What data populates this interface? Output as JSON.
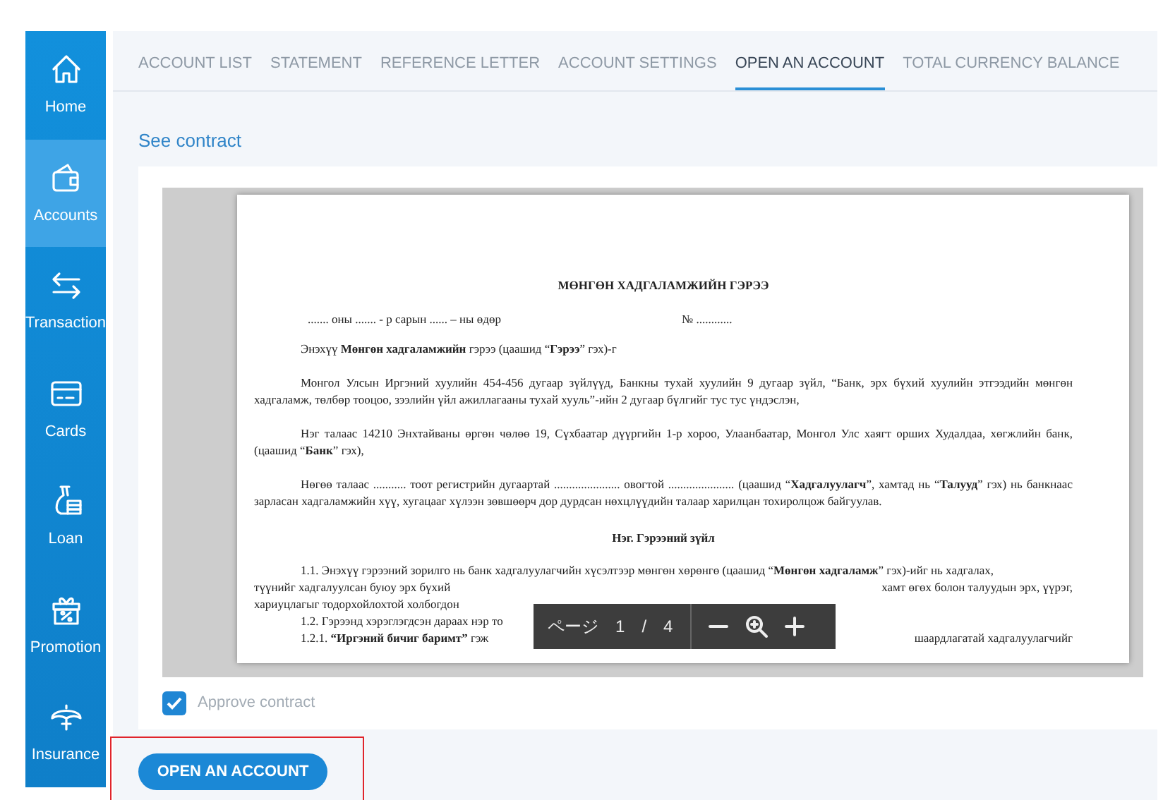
{
  "sidebar": {
    "items": [
      {
        "label": "Home",
        "selected": false
      },
      {
        "label": "Accounts",
        "selected": true
      },
      {
        "label": "Transaction",
        "selected": false
      },
      {
        "label": "Cards",
        "selected": false
      },
      {
        "label": "Loan",
        "selected": false
      },
      {
        "label": "Promotion",
        "selected": false
      },
      {
        "label": "Insurance",
        "selected": false
      }
    ]
  },
  "tabs": [
    {
      "label": "ACCOUNT LIST",
      "selected": false
    },
    {
      "label": "STATEMENT",
      "selected": false
    },
    {
      "label": "REFERENCE LETTER",
      "selected": false
    },
    {
      "label": "ACCOUNT SETTINGS",
      "selected": false
    },
    {
      "label": "OPEN AN ACCOUNT",
      "selected": true
    },
    {
      "label": "TOTAL CURRENCY BALANCE",
      "selected": false
    }
  ],
  "section_title": "See contract",
  "document": {
    "title": "МӨНГӨН ХАДГАЛАМЖИЙН ГЭРЭЭ",
    "date_line": "....... оны ....... - р сарын ...... – ны өдөр",
    "number_line": "№ ............",
    "paragraphs": [
      "Энэхүү **Мөнгөн хадгаламжийн** гэрээ (цаашид “**Гэрээ**” гэх)-г",
      "Монгол Улсын Иргэний хуулийн 454-456 дугаар зүйлүүд, Банкны тухай хуулийн 9 дугаар зүйл, “Банк, эрх бүхий хуулийн этгээдийн мөнгөн хадгаламж, төлбөр тооцоо, зээлийн үйл ажиллагааны тухай хууль”-ийн 2 дугаар бүлгийг тус тус үндэслэн,",
      "Нэг талаас 14210 Энхтайваны өргөн чөлөө 19, Сүхбаатар дүүргийн 1-р хороо, Улаанбаатар, Монгол Улс хаягт орших Худалдаа, хөгжлийн банк, (цаашид “**Банк**” гэх),",
      "Нөгөө талаас ........... тоот регистрийн дугаартай ...................... овогтой ...................... (цаашид “**Хадгалуулагч**”, хамтад нь “**Талууд**” гэх) нь банкнаас зарласан хадгаламжийн хүү, хугацааг хүлээн зөвшөөрч дор дурдсан нөхцлүүдийн талаар харилцан тохиролцож байгуулав."
    ],
    "section_heading": "Нэг. Гэрээний зүйл",
    "lines": [
      {
        "text": "1.1. Энэхүү гэрээний зорилго нь банк хадгалуулагчийн хүсэлтээр мөнгөн хөрөнгө (цаашид “**Мөнгөн хадгаламж**” гэх)-ийг нь хадгалах,",
        "indented": true
      },
      {
        "text": "түүнийг хадгалуулсан буюу эрх бүхий",
        "text_right": "хамт өгөх болон талуудын эрх, үүрэг,",
        "indented": false
      },
      {
        "text": "хариуцлагыг тодорхойлохтой холбогдон",
        "indented": false
      },
      {
        "text": "1.2. Гэрээнд хэрэглэгдсэн дараах нэр то",
        "indented": true
      },
      {
        "text": "1.2.1. **“Иргэний бичиг баримт”** гэж",
        "text_right": "шаардлагатай хадгалуулагчийг",
        "indented": true
      }
    ]
  },
  "viewer_toolbar": {
    "page_label": "ページ",
    "page": "1",
    "separator": "/",
    "total": "4"
  },
  "approve": {
    "label": "Approve contract",
    "checked": true
  },
  "button": {
    "label": "OPEN AN ACCOUNT",
    "highlighted": true
  }
}
